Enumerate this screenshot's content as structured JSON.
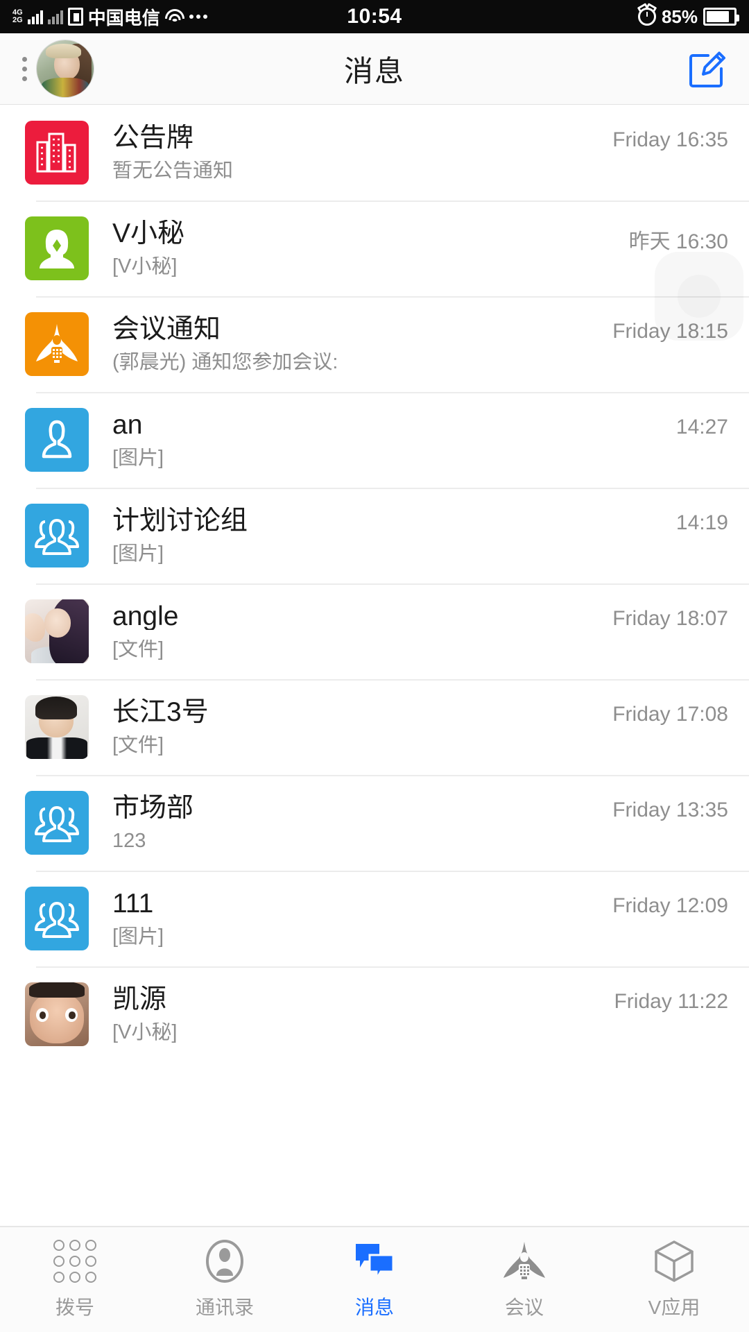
{
  "status_bar": {
    "network_gen_top": "4G",
    "network_gen_bottom": "2G",
    "carrier": "中国电信",
    "time": "10:54",
    "battery_percent": "85%",
    "icons": [
      "signal-bars-icon",
      "sim-card-icon",
      "wifi-icon",
      "more-dots-icon",
      "alarm-clock-icon",
      "battery-icon"
    ]
  },
  "header": {
    "title": "消息",
    "menu_icon": "vertical-dots-icon",
    "avatar": "user-avatar",
    "compose_icon": "compose-edit-icon",
    "accent_color": "#1a6eff"
  },
  "chats": [
    {
      "name": "公告牌",
      "preview": "暂无公告通知",
      "time": "Friday 16:35",
      "avatar_type": "icon-bulletin",
      "avatar_color": "#ec1c3d"
    },
    {
      "name": "V小秘",
      "preview": "[V小秘]",
      "time": "昨天 16:30",
      "avatar_type": "icon-assistant",
      "avatar_color": "#7dc11c"
    },
    {
      "name": "会议通知",
      "preview": "(郭晨光) 通知您参加会议:",
      "time": "Friday 18:15",
      "avatar_type": "icon-meeting",
      "avatar_color": "#f49105"
    },
    {
      "name": "an",
      "preview": "[图片]",
      "time": "14:27",
      "avatar_type": "icon-person",
      "avatar_color": "#32a6e0"
    },
    {
      "name": "计划讨论组",
      "preview": "[图片]",
      "time": "14:19",
      "avatar_type": "icon-group",
      "avatar_color": "#32a6e0"
    },
    {
      "name": "angle",
      "preview": "[文件]",
      "time": "Friday 18:07",
      "avatar_type": "photo-angle",
      "avatar_color": ""
    },
    {
      "name": "长江3号",
      "preview": "[文件]",
      "time": "Friday 17:08",
      "avatar_type": "photo-man",
      "avatar_color": ""
    },
    {
      "name": "市场部",
      "preview": "123",
      "time": "Friday 13:35",
      "avatar_type": "icon-group",
      "avatar_color": "#32a6e0"
    },
    {
      "name": "111",
      "preview": "[图片]",
      "time": "Friday 12:09",
      "avatar_type": "icon-group",
      "avatar_color": "#32a6e0"
    },
    {
      "name": "凯源",
      "preview": "[V小秘]",
      "time": "Friday 11:22",
      "avatar_type": "photo-toon",
      "avatar_color": ""
    }
  ],
  "tabbar": {
    "active_index": 2,
    "items": [
      {
        "label": "拨号",
        "icon": "dialpad-icon"
      },
      {
        "label": "通讯录",
        "icon": "contacts-person-icon"
      },
      {
        "label": "消息",
        "icon": "chat-bubbles-icon"
      },
      {
        "label": "会议",
        "icon": "meeting-podium-icon"
      },
      {
        "label": "V应用",
        "icon": "cube-apps-icon"
      }
    ]
  }
}
